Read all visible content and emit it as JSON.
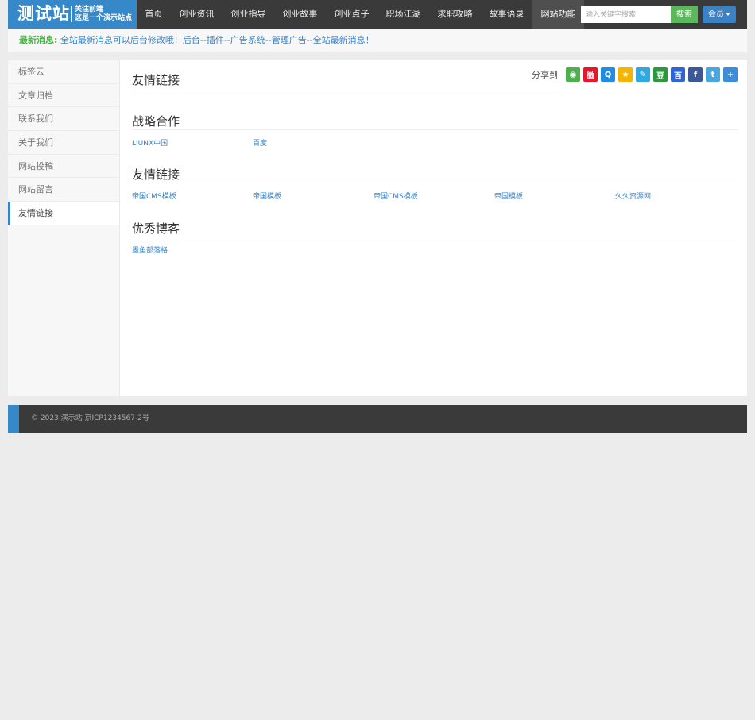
{
  "logo": {
    "title": "测试站",
    "line1": "关注前端",
    "line2": "这是一个演示站点"
  },
  "nav": [
    {
      "label": "首页"
    },
    {
      "label": "创业资讯"
    },
    {
      "label": "创业指导"
    },
    {
      "label": "创业故事"
    },
    {
      "label": "创业点子"
    },
    {
      "label": "职场江湖"
    },
    {
      "label": "求职攻略"
    },
    {
      "label": "故事语录"
    },
    {
      "label": "网站功能"
    }
  ],
  "search": {
    "placeholder": "输入关键字搜索",
    "button": "搜索"
  },
  "member": {
    "label": "会员"
  },
  "notice": {
    "label": "最新消息:",
    "text": "全站最新消息可以后台修改哦！后台--插件--广告系统--管理广告--全站最新消息！"
  },
  "sidebar": [
    {
      "label": "标签云"
    },
    {
      "label": "文章归档"
    },
    {
      "label": "联系我们"
    },
    {
      "label": "关于我们"
    },
    {
      "label": "网站投稿"
    },
    {
      "label": "网站留言"
    },
    {
      "label": "友情链接"
    }
  ],
  "page": {
    "title": "友情链接",
    "share_label": "分享到"
  },
  "share_icons": [
    {
      "name": "wechat-icon",
      "color": "#4cb04c",
      "glyph": "◉"
    },
    {
      "name": "weibo-icon",
      "color": "#e6162d",
      "glyph": "微"
    },
    {
      "name": "qq-icon",
      "color": "#1f8ce6",
      "glyph": "Q"
    },
    {
      "name": "qzone-icon",
      "color": "#f4b400",
      "glyph": "★"
    },
    {
      "name": "tencent-weibo-icon",
      "color": "#2fa8e1",
      "glyph": "✎"
    },
    {
      "name": "douban-icon",
      "color": "#2e963d",
      "glyph": "豆"
    },
    {
      "name": "baidu-icon",
      "color": "#2d65d8",
      "glyph": "百"
    },
    {
      "name": "facebook-icon",
      "color": "#3b5998",
      "glyph": "f"
    },
    {
      "name": "twitter-icon",
      "color": "#4aa6df",
      "glyph": "t"
    },
    {
      "name": "more-share-icon",
      "color": "#3a8dd6",
      "glyph": "+"
    }
  ],
  "sections": [
    {
      "title": "战略合作",
      "links": [
        "LIUNX中国",
        "百度"
      ]
    },
    {
      "title": "友情链接",
      "links": [
        "帝国CMS模板",
        "帝国模板",
        "帝国CMS模板",
        "帝国模板",
        "久久资源网"
      ]
    },
    {
      "title": "优秀博客",
      "links": [
        "墨鱼部落格"
      ]
    }
  ],
  "footer": {
    "copyright": "© 2023 演示站    京ICP1234567-2号"
  }
}
